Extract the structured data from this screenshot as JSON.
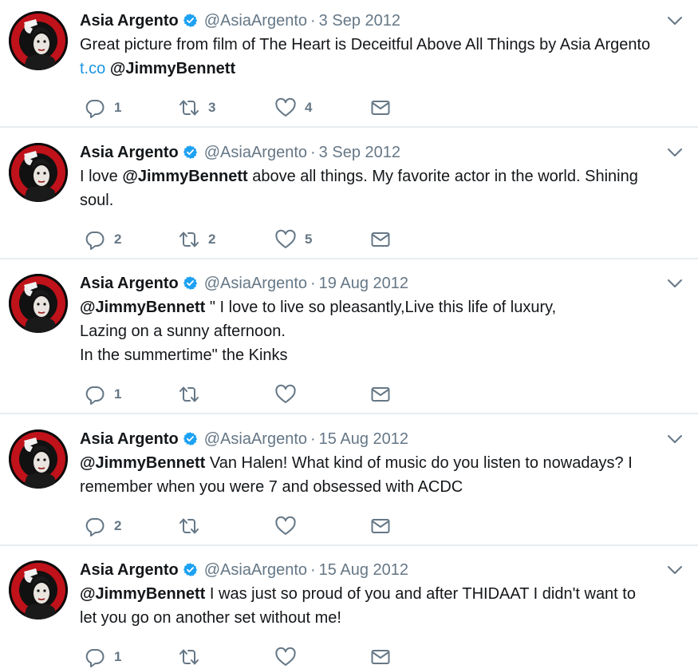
{
  "tweets": [
    {
      "name": "Asia Argento",
      "handle": "@AsiaArgento",
      "separator": "·",
      "date": "3 Sep 2012",
      "lines": [
        [
          {
            "t": "Great picture from film of The Heart is Deceitful Above All Things by Asia Argento",
            "s": "text"
          }
        ],
        [
          {
            "t": "t.co",
            "s": "link"
          },
          {
            "t": " ",
            "s": "text"
          },
          {
            "t": "@JimmyBennett",
            "s": "mention"
          }
        ]
      ],
      "replies": "1",
      "retweets": "3",
      "likes": "4"
    },
    {
      "name": "Asia Argento",
      "handle": "@AsiaArgento",
      "separator": "·",
      "date": "3 Sep 2012",
      "lines": [
        [
          {
            "t": "I love ",
            "s": "text"
          },
          {
            "t": "@JimmyBennett",
            "s": "mention"
          },
          {
            "t": " above all things. My favorite actor in the world. Shining",
            "s": "text"
          }
        ],
        [
          {
            "t": "soul.",
            "s": "text"
          }
        ]
      ],
      "replies": "2",
      "retweets": "2",
      "likes": "5"
    },
    {
      "name": "Asia Argento",
      "handle": "@AsiaArgento",
      "separator": "·",
      "date": "19 Aug 2012",
      "lines": [
        [
          {
            "t": "@JimmyBennett",
            "s": "mention"
          },
          {
            "t": " \" I love to live so pleasantly,Live this life of luxury,",
            "s": "text"
          }
        ],
        [
          {
            "t": "Lazing on a sunny afternoon.",
            "s": "text"
          }
        ],
        [
          {
            "t": "In the summertime\" the Kinks",
            "s": "text"
          }
        ]
      ],
      "replies": "1",
      "retweets": "",
      "likes": ""
    },
    {
      "name": "Asia Argento",
      "handle": "@AsiaArgento",
      "separator": "·",
      "date": "15 Aug 2012",
      "lines": [
        [
          {
            "t": "@JimmyBennett",
            "s": "mention"
          },
          {
            "t": " Van Halen! What kind of music do you listen to nowadays? I",
            "s": "text"
          }
        ],
        [
          {
            "t": "remember when you were 7 and obsessed with ACDC",
            "s": "text"
          }
        ]
      ],
      "replies": "2",
      "retweets": "",
      "likes": ""
    },
    {
      "name": "Asia Argento",
      "handle": "@AsiaArgento",
      "separator": "·",
      "date": "15 Aug 2012",
      "lines": [
        [
          {
            "t": "@JimmyBennett",
            "s": "mention"
          },
          {
            "t": " I was just so proud of you and after THIDAAT I didn't want to",
            "s": "text"
          }
        ],
        [
          {
            "t": "let you go on another set without me!",
            "s": "text"
          }
        ]
      ],
      "replies": "1",
      "retweets": "",
      "likes": ""
    }
  ],
  "icons": {
    "avatar": "avatar-raised-fist-portrait",
    "verified": "verified-badge-icon",
    "menu": "chevron-down-icon",
    "reply": "reply-icon",
    "retweet": "retweet-icon",
    "like": "heart-icon",
    "message": "envelope-icon"
  },
  "colors": {
    "text": "#14171a",
    "muted": "#657786",
    "link": "#1b95e0",
    "verified": "#1da1f2",
    "divider": "#e6ecf0",
    "avatar_ring": "#c0121a"
  }
}
